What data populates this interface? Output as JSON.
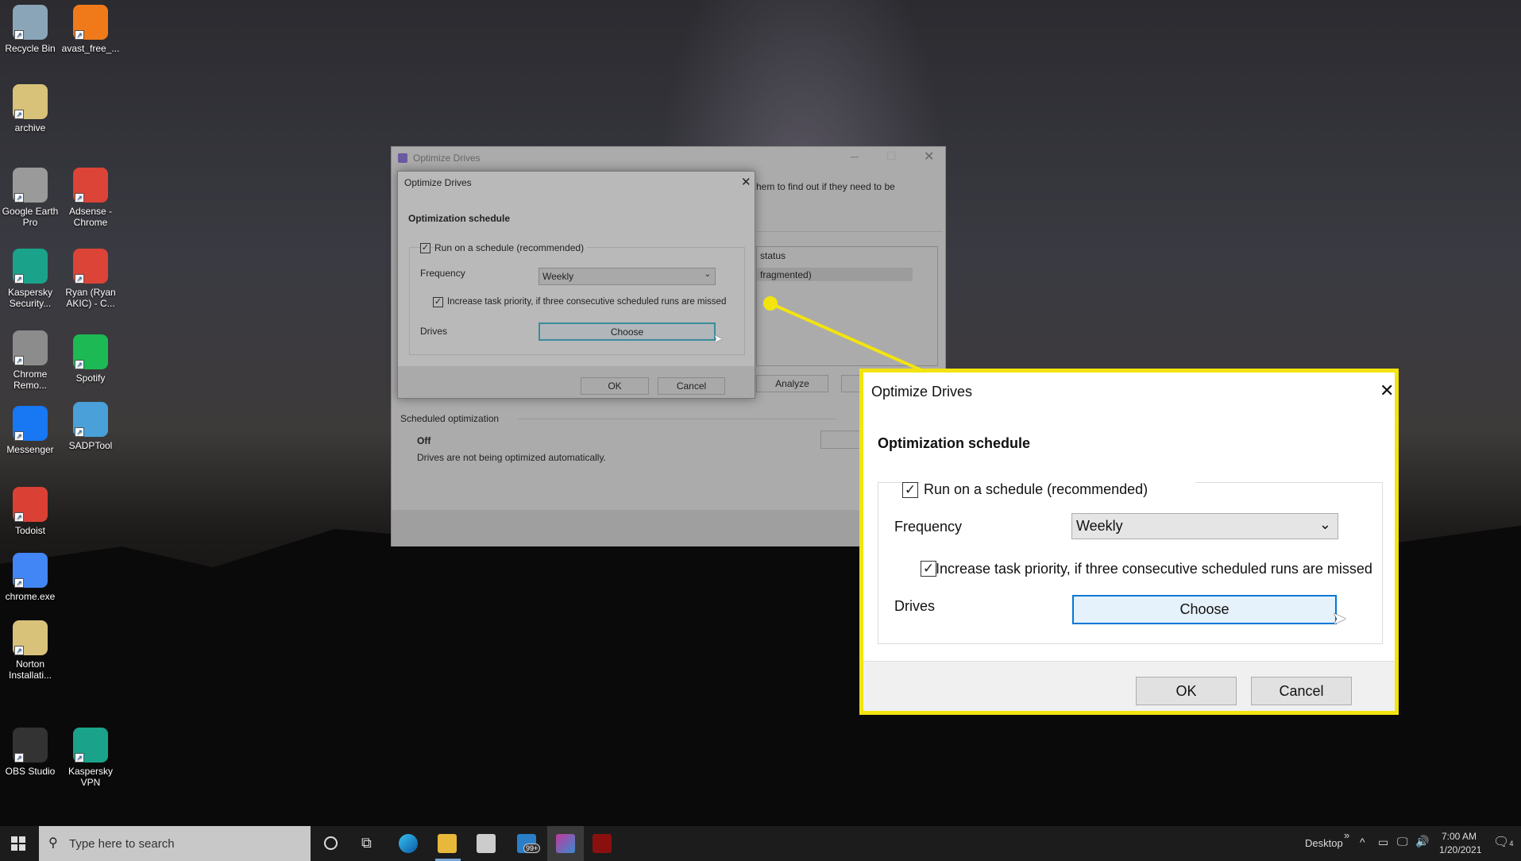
{
  "desktop": {
    "icons": [
      {
        "label": "Recycle Bin",
        "color": "#8aa5b8"
      },
      {
        "label": "avast_free_...",
        "color": "#f07a1a"
      },
      {
        "label": "archive",
        "color": "#d8c27a"
      },
      {
        "label": "Google Earth Pro",
        "color": "#9a9a9a"
      },
      {
        "label": "Adsense - Chrome",
        "color": "#db4437"
      },
      {
        "label": "Kaspersky Security...",
        "color": "#1aa38a"
      },
      {
        "label": "Ryan (Ryan AKIC) - C...",
        "color": "#db4437"
      },
      {
        "label": "Chrome Remo...",
        "color": "#8c8c8c"
      },
      {
        "label": "Spotify",
        "color": "#1db954"
      },
      {
        "label": "Messenger",
        "color": "#1877f2"
      },
      {
        "label": "SADPTool",
        "color": "#4aa0d8"
      },
      {
        "label": "Todoist",
        "color": "#db4035"
      },
      {
        "label": "chrome.exe",
        "color": "#4285f4"
      },
      {
        "label": "Norton Installati...",
        "color": "#d8c27a"
      },
      {
        "label": "OBS Studio",
        "color": "#333333"
      },
      {
        "label": "Kaspersky VPN",
        "color": "#1aa38a"
      }
    ]
  },
  "main_window": {
    "title": "Optimize Drives",
    "partial_text": "hem to find out if they need to be",
    "list_header": "status",
    "list_row": "fragmented)",
    "analyze": "Analyze",
    "scheduled_label": "Scheduled optimization",
    "status": "Off",
    "status_desc": "Drives are not being optimized automatically."
  },
  "dialog": {
    "title": "Optimize Drives",
    "heading": "Optimization schedule",
    "run_on_schedule": "Run on a schedule (recommended)",
    "run_checked": true,
    "frequency_label": "Frequency",
    "frequency_value": "Weekly",
    "priority_label": "Increase task priority, if three consecutive scheduled runs are missed",
    "priority_checked": true,
    "drives_label": "Drives",
    "choose": "Choose",
    "ok": "OK",
    "cancel": "Cancel"
  },
  "highlight_color": "#f3e40f",
  "taskbar": {
    "search_placeholder": "Type here to search",
    "badge": "99+",
    "desktop_label": "Desktop",
    "chevron": "»",
    "time": "7:00 AM",
    "date": "1/20/2021",
    "notif_count": "4"
  }
}
